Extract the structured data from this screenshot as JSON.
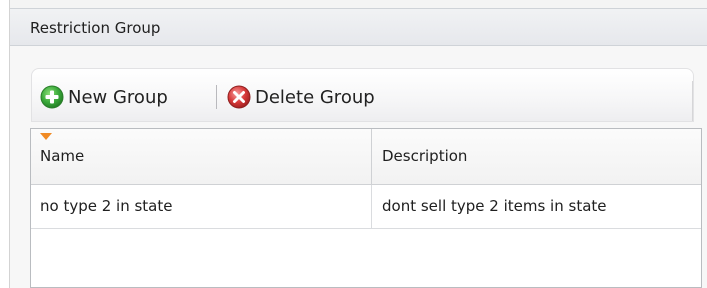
{
  "panel": {
    "title": "Restriction Group"
  },
  "toolbar": {
    "new_group": {
      "label": "New Group",
      "icon": "add-green-circle-icon",
      "color": "#3cab3c"
    },
    "delete_group": {
      "label": "Delete Group",
      "icon": "delete-red-circle-icon",
      "color": "#d83a3a"
    }
  },
  "grid": {
    "columns": [
      {
        "key": "name",
        "label": "Name"
      },
      {
        "key": "description",
        "label": "Description"
      }
    ],
    "rows": [
      {
        "name": "no type 2 in state",
        "description": "dont sell type 2 items in state"
      }
    ],
    "filter_indicator_color": "#f08a24"
  }
}
